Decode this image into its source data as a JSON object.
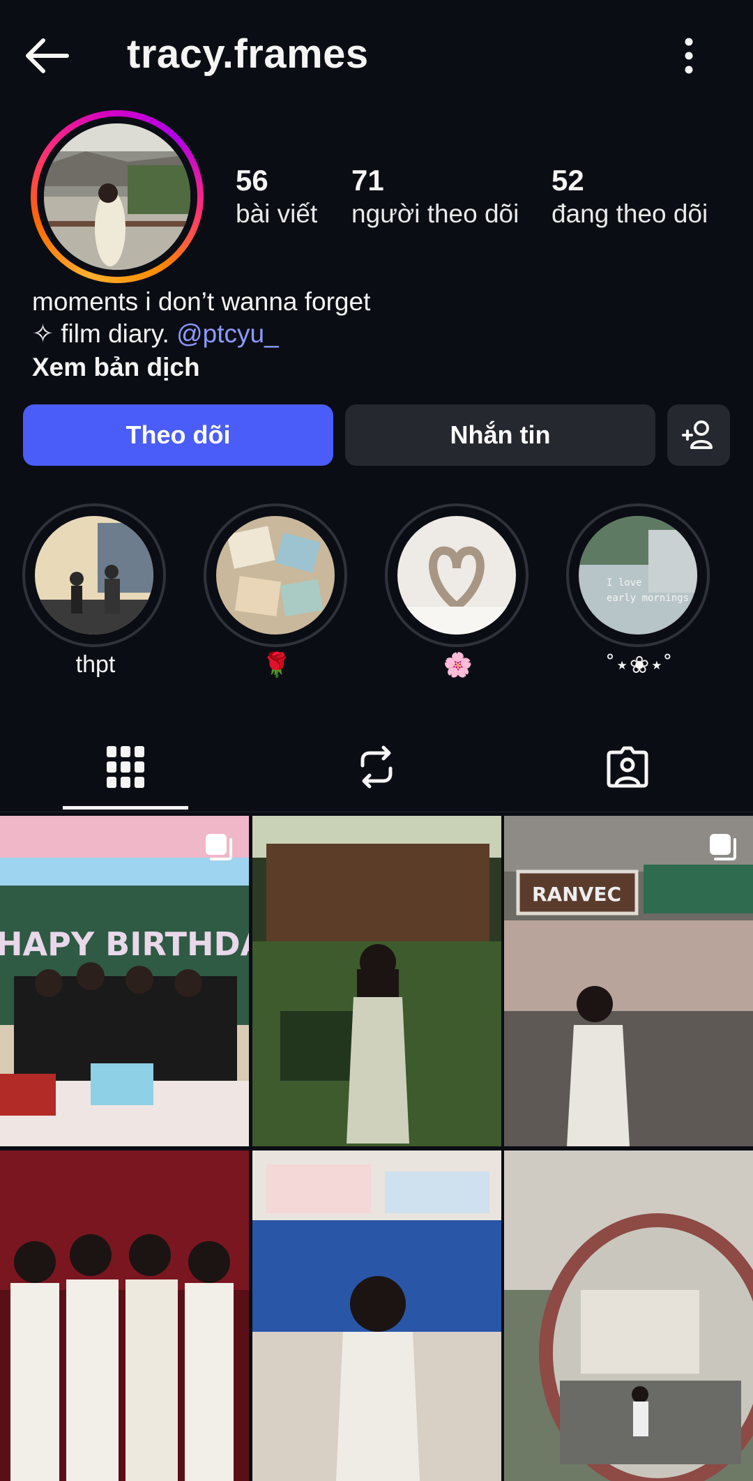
{
  "header": {
    "title": "tracy.frames",
    "back_icon": "arrow-left-icon",
    "more_icon": "more-vertical-icon"
  },
  "stats": [
    {
      "value": "56",
      "label": "bài viết"
    },
    {
      "value": "71",
      "label": "người theo dõi"
    },
    {
      "value": "52",
      "label": "đang theo dõi"
    }
  ],
  "bio": {
    "line1": "moments i don’t wanna forget",
    "line2_prefix": "✧ film diary.",
    "mention": "@ptcyu_",
    "translate": "Xem bản dịch"
  },
  "actions": {
    "follow": "Theo dõi",
    "message": "Nhắn tin",
    "add_person_icon": "add-person-icon"
  },
  "highlights": [
    {
      "label": "thpt"
    },
    {
      "label": "🌹"
    },
    {
      "label": "🌸"
    },
    {
      "label": "˚⋆❀⋆˚",
      "overlay_text": "I love\nearly mornings"
    }
  ],
  "tabs": [
    {
      "name": "posts",
      "icon": "grid-icon",
      "active": true
    },
    {
      "name": "reposts",
      "icon": "repost-icon",
      "active": false
    },
    {
      "name": "tagged",
      "icon": "tagged-person-icon",
      "active": false
    }
  ],
  "posts": [
    {
      "id": "post-1",
      "multi": true,
      "caption": "HAPY BIRTHDAY"
    },
    {
      "id": "post-2",
      "multi": false
    },
    {
      "id": "post-3",
      "multi": true,
      "caption": "RANVEC"
    },
    {
      "id": "post-4",
      "multi": false
    },
    {
      "id": "post-5",
      "multi": false
    },
    {
      "id": "post-6",
      "multi": false
    }
  ],
  "colors": {
    "background": "#0b0d14",
    "accent": "#4a5df9",
    "mention": "#8b9bff",
    "button_secondary": "#262830"
  }
}
